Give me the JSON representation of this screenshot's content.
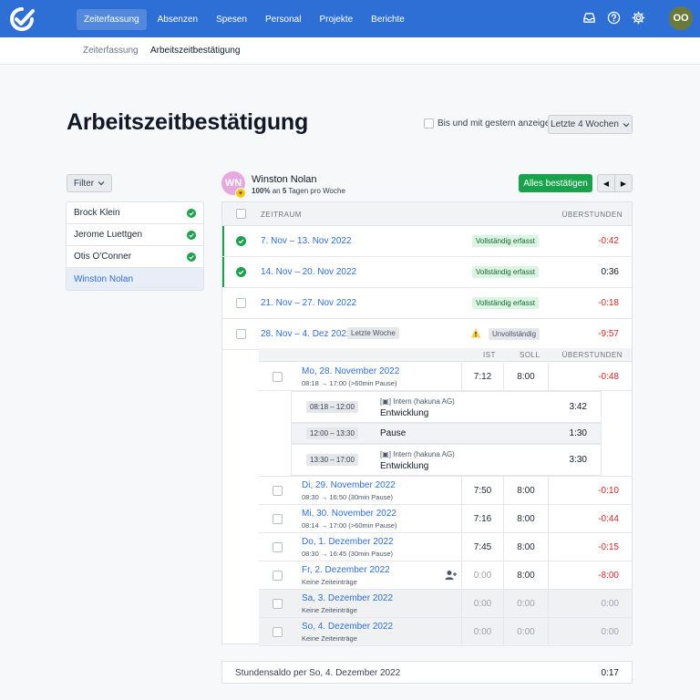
{
  "nav": {
    "items": [
      "Zeiterfassung",
      "Absenzen",
      "Spesen",
      "Personal",
      "Projekte",
      "Berichte"
    ],
    "active": "Zeiterfassung",
    "avatar_initials": "OO",
    "icons": [
      "inbox-icon",
      "help-icon",
      "gear-icon"
    ]
  },
  "breadcrumb": {
    "items": [
      "Zeiterfassung",
      "Arbeitszeitbestätigung"
    ]
  },
  "page": {
    "title": "Arbeitszeitbestätigung",
    "yesterday_label": "Bis und mit gestern anzeigen",
    "range_select": "Letzte 4 Wochen"
  },
  "filter": {
    "label": "Filter"
  },
  "people": [
    {
      "name": "Brock Klein",
      "done": true
    },
    {
      "name": "Jerome Luettgen",
      "done": true
    },
    {
      "name": "Otis O'Conner",
      "done": true
    },
    {
      "name": "Winston Nolan",
      "done": false,
      "selected": true
    }
  ],
  "employee": {
    "initials": "WN",
    "name": "Winston Nolan",
    "workload_pct": "100%",
    "workload_mid": " an ",
    "workload_days": "5",
    "workload_suffix": " Tagen pro Woche",
    "confirm_all": "Alles bestätigen"
  },
  "table": {
    "col_period": "ZEITRAUM",
    "col_overtime": "ÜBERSTUNDEN",
    "weeks": [
      {
        "label": "7. Nov – 13. Nov 2022",
        "status": "Vollständig erfasst",
        "overtime": "-0:42",
        "confirmed": true
      },
      {
        "label": "14. Nov – 20. Nov 2022",
        "status": "Vollständig erfasst",
        "overtime": "0:36",
        "confirmed": true
      },
      {
        "label": "21. Nov – 27. Nov 2022",
        "status": "Vollständig erfasst",
        "overtime": "-0:18",
        "confirmed": false
      },
      {
        "label": "28. Nov – 4. Dez 2022",
        "tag": "Letzte Woche",
        "status": "Unvollständig",
        "overtime": "-9:57",
        "confirmed": false,
        "warning": true
      }
    ]
  },
  "days": {
    "col_ist": "IST",
    "col_soll": "SOLL",
    "col_overtime": "ÜBERSTUNDEN",
    "rows": [
      {
        "date": "Mo, 28. November 2022",
        "sub": "08:18 → 17:00 (>60min Pause)",
        "ist": "7:12",
        "soll": "8:00",
        "over": "-0:48"
      },
      {
        "date": "Di, 29. November 2022",
        "sub": "08:30 → 16:50 (30min Pause)",
        "ist": "7:50",
        "soll": "8:00",
        "over": "-0:10"
      },
      {
        "date": "Mi, 30. November 2022",
        "sub": "08:14 → 17:00 (>60min Pause)",
        "ist": "7:16",
        "soll": "8:00",
        "over": "-0:44"
      },
      {
        "date": "Do, 1. Dezember 2022",
        "sub": "08:30 → 16:45 (30min Pause)",
        "ist": "7:45",
        "soll": "8:00",
        "over": "-0:15"
      },
      {
        "date": "Fr, 2. Dezember 2022",
        "sub": "Keine Zeiteinträge",
        "ist": "0:00",
        "soll": "8:00",
        "over": "-8:00"
      },
      {
        "date": "Sa, 3. Dezember 2022",
        "sub": "Keine Zeiteinträge",
        "ist": "0:00",
        "soll": "0:00",
        "over": "0:00"
      },
      {
        "date": "So, 4. Dezember 2022",
        "sub": "Keine Zeiteinträge",
        "ist": "0:00",
        "soll": "0:00",
        "over": "0:00"
      }
    ],
    "entries": [
      {
        "time": "08:18 – 12:00",
        "project": "Intern (hakuna AG)",
        "activity": "Entwicklung",
        "duration": "3:42"
      },
      {
        "time": "12:00 – 13:30",
        "activity": "Pause",
        "duration": "1:30"
      },
      {
        "time": "13:30 – 17:00",
        "project": "Intern (hakuna AG)",
        "activity": "Entwicklung",
        "duration": "3:30"
      }
    ]
  },
  "saldo": {
    "label": "Stundensaldo per So, 4. Dezember 2022",
    "value": "0:17"
  },
  "colors": {
    "brand": "#2e6fd6",
    "success": "#16a34a",
    "negative": "#dc2626"
  }
}
